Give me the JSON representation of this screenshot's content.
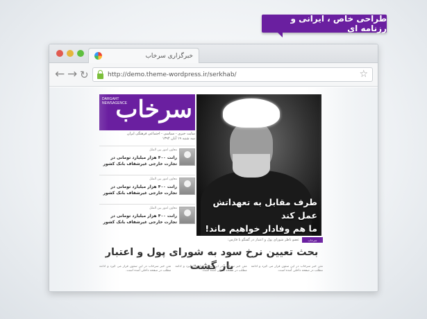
{
  "promo": {
    "title": "طراحی خاص ، ایرانی و رزنامه ای"
  },
  "browser": {
    "tab_title": "خبرگزاری سرخاب",
    "url": "http://demo.theme-wordpress.ir/serkhab/",
    "icons": {
      "back": "back-arrow-icon",
      "forward": "forward-arrow-icon",
      "reload": "reload-icon",
      "secure": "lock-icon",
      "bookmark": "star-icon",
      "favicon": "favicon-icon"
    }
  },
  "newspaper": {
    "masthead": {
      "logo": "سرخاب",
      "sub_line1": "DARGAHT",
      "sub_line2": "NEWSAGENCE"
    },
    "tagline": "سایت خبری - سیاسی - اجتماعی فرهنگی ایران",
    "date_line": "سه شنبه ۱۹ آبان ۱۳۹۴",
    "hero_headline_line1": "طرف مقابل به تعهداتش عمل کند",
    "hero_headline_line2": "ما هم وفادار خواهیم ماند!",
    "section_label": "سرخاب",
    "sub_kicker": "عضو ناظر شورای پول و اعتبار در گفتگو با فارس:",
    "main_headline": "بحث تعیین نرخ سود به شورای پول و اعتبار باز گشت",
    "news_items": [
      {
        "kicker": "معاون امور بین الملل",
        "title": "رانت ۴۰۰ هزار میلیارد تومانی در تجارت خارجی غیرشفاف بانک کشور"
      },
      {
        "kicker": "معاون امور بین الملل",
        "title": "رانت ۴۰۰ هزار میلیارد تومانی در تجارت خارجی غیرشفاف بانک کشور"
      },
      {
        "kicker": "معاون امور بین الملل",
        "title": "رانت ۴۰۰ هزار میلیارد تومانی در تجارت خارجی غیرشفاف بانک کشور"
      }
    ],
    "body_columns": [
      "متن خبر سرخاب در این ستون قرار می گیرد و ادامه مطلب در صفحه داخلی آمده است.",
      "متن خبر سرخاب در این ستون قرار می گیرد و ادامه مطلب در صفحه داخلی آمده است.",
      "متن خبر سرخاب در این ستون قرار می گیرد و ادامه مطلب در صفحه داخلی آمده است."
    ]
  }
}
